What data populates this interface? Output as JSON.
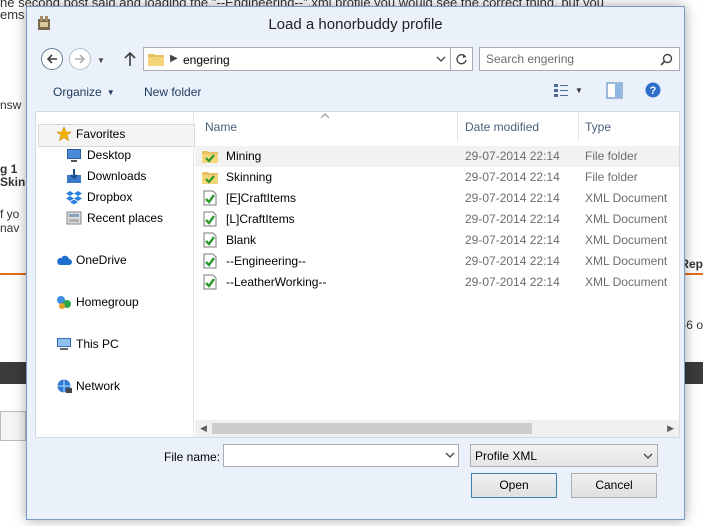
{
  "background": {
    "top_line_1": "he second post said and loading the \"--Engineering--\".xml profile you would see the correct thing, but you",
    "top_line_2": "ems",
    "left_frag_1": "nsw",
    "left_frag_2": "g 1",
    "left_frag_3": "Skin",
    "left_frag_4": "f yo",
    "left_frag_5": "nav",
    "right_frag_1": "Rep",
    "right_frag_2": "-6 o"
  },
  "dialog": {
    "title": "Load a honorbuddy profile"
  },
  "nav": {
    "path": "engering",
    "search_placeholder": "Search engering"
  },
  "commands": {
    "organize": "Organize",
    "new_folder": "New folder"
  },
  "sidebar": {
    "items": [
      {
        "label": "Favorites"
      },
      {
        "label": "Desktop"
      },
      {
        "label": "Downloads"
      },
      {
        "label": "Dropbox"
      },
      {
        "label": "Recent places"
      },
      {
        "label": "OneDrive"
      },
      {
        "label": "Homegroup"
      },
      {
        "label": "This PC"
      },
      {
        "label": "Network"
      }
    ]
  },
  "columns": {
    "name": "Name",
    "date": "Date modified",
    "type": "Type"
  },
  "files": [
    {
      "name": "Mining",
      "date": "29-07-2014 22:14",
      "type": "File folder",
      "kind": "folder"
    },
    {
      "name": "Skinning",
      "date": "29-07-2014 22:14",
      "type": "File folder",
      "kind": "folder"
    },
    {
      "name": "[E]CraftItems",
      "date": "29-07-2014 22:14",
      "type": "XML Document",
      "kind": "xml"
    },
    {
      "name": "[L]CraftItems",
      "date": "29-07-2014 22:14",
      "type": "XML Document",
      "kind": "xml"
    },
    {
      "name": "Blank",
      "date": "29-07-2014 22:14",
      "type": "XML Document",
      "kind": "xml"
    },
    {
      "name": "--Engineering--",
      "date": "29-07-2014 22:14",
      "type": "XML Document",
      "kind": "xml"
    },
    {
      "name": "--LeatherWorking--",
      "date": "29-07-2014 22:14",
      "type": "XML Document",
      "kind": "xml"
    }
  ],
  "footer": {
    "file_name_label": "File name:",
    "file_name_value": "",
    "file_type": "Profile XML",
    "open": "Open",
    "cancel": "Cancel"
  }
}
